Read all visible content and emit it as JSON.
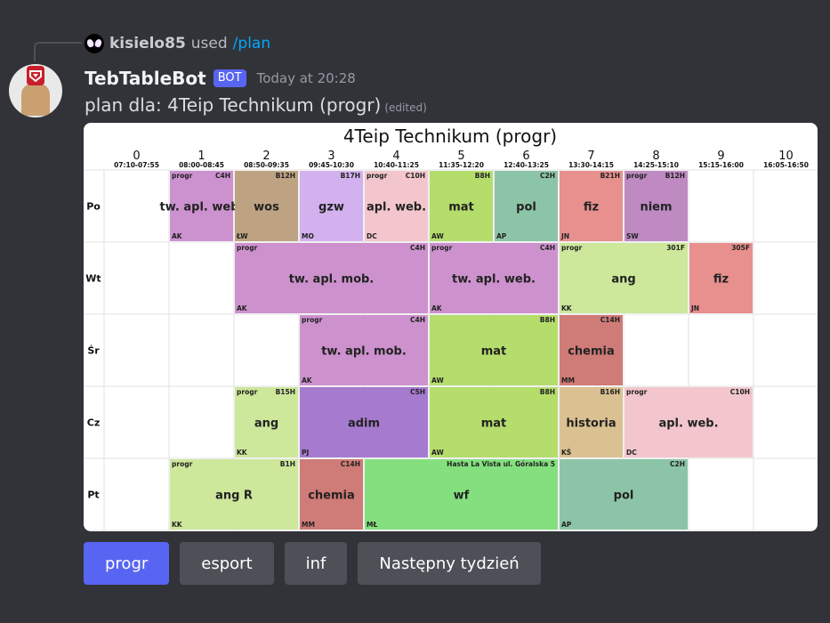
{
  "reply": {
    "user": "kisielo85",
    "verb": "used",
    "command": "/plan"
  },
  "message": {
    "bot_name": "TebTableBot",
    "bot_badge": "BOT",
    "timestamp": "Today at 20:28",
    "content": "plan dla: 4Teip Technikum (progr)",
    "edited": "(edited)"
  },
  "timetable": {
    "title": "4Teip Technikum (progr)",
    "periods": [
      {
        "num": "0",
        "time": "07:10-07:55"
      },
      {
        "num": "1",
        "time": "08:00-08:45"
      },
      {
        "num": "2",
        "time": "08:50-09:35"
      },
      {
        "num": "3",
        "time": "09:45-10:30"
      },
      {
        "num": "4",
        "time": "10:40-11:25"
      },
      {
        "num": "5",
        "time": "11:35-12:20"
      },
      {
        "num": "6",
        "time": "12:40-13:25"
      },
      {
        "num": "7",
        "time": "13:30-14:15"
      },
      {
        "num": "8",
        "time": "14:25-15:10"
      },
      {
        "num": "9",
        "time": "15:15-16:00"
      },
      {
        "num": "10",
        "time": "16:05-16:50"
      }
    ],
    "days": [
      "Po",
      "Wt",
      "Śr",
      "Cz",
      "Pt"
    ],
    "lessons": [
      {
        "day": 0,
        "start": 1,
        "span": 1,
        "name": "tw. apl. web.",
        "group": "progr",
        "room": "C4H",
        "teacher": "AK",
        "color": "#cc91cf"
      },
      {
        "day": 0,
        "start": 2,
        "span": 1,
        "name": "wos",
        "group": "",
        "room": "B12H",
        "teacher": "ŁW",
        "color": "#bea382"
      },
      {
        "day": 0,
        "start": 3,
        "span": 1,
        "name": "gzw",
        "group": "",
        "room": "B17H",
        "teacher": "MO",
        "color": "#d3b1ee"
      },
      {
        "day": 0,
        "start": 4,
        "span": 1,
        "name": "apl. web.",
        "group": "progr",
        "room": "C10H",
        "teacher": "DC",
        "color": "#f2c6cc"
      },
      {
        "day": 0,
        "start": 5,
        "span": 1,
        "name": "mat",
        "group": "",
        "room": "B8H",
        "teacher": "AW",
        "color": "#b5dd6c"
      },
      {
        "day": 0,
        "start": 6,
        "span": 1,
        "name": "pol",
        "group": "",
        "room": "C2H",
        "teacher": "AP",
        "color": "#8cc4a7"
      },
      {
        "day": 0,
        "start": 7,
        "span": 1,
        "name": "fiz",
        "group": "",
        "room": "B21H",
        "teacher": "JN",
        "color": "#e7908e"
      },
      {
        "day": 0,
        "start": 8,
        "span": 1,
        "name": "niem",
        "group": "progr",
        "room": "B12H",
        "teacher": "SW",
        "color": "#bf8ac2"
      },
      {
        "day": 1,
        "start": 2,
        "span": 3,
        "name": "tw. apl. mob.",
        "group": "progr",
        "room": "C4H",
        "teacher": "AK",
        "color": "#cd92ce"
      },
      {
        "day": 1,
        "start": 5,
        "span": 2,
        "name": "tw. apl. web.",
        "group": "progr",
        "room": "C4H",
        "teacher": "AK",
        "color": "#cd92ce"
      },
      {
        "day": 1,
        "start": 7,
        "span": 2,
        "name": "ang",
        "group": "progr",
        "room": "301F",
        "teacher": "KK",
        "color": "#cde79b"
      },
      {
        "day": 1,
        "start": 9,
        "span": 1,
        "name": "fiz",
        "group": "",
        "room": "305F",
        "teacher": "JN",
        "color": "#e7908e"
      },
      {
        "day": 2,
        "start": 3,
        "span": 2,
        "name": "tw. apl. mob.",
        "group": "progr",
        "room": "C4H",
        "teacher": "AK",
        "color": "#cd92ce"
      },
      {
        "day": 2,
        "start": 5,
        "span": 2,
        "name": "mat",
        "group": "",
        "room": "B8H",
        "teacher": "AW",
        "color": "#b5dd6c"
      },
      {
        "day": 2,
        "start": 7,
        "span": 1,
        "name": "chemia",
        "group": "",
        "room": "C14H",
        "teacher": "MM",
        "color": "#cf7b77"
      },
      {
        "day": 3,
        "start": 2,
        "span": 1,
        "name": "ang",
        "group": "progr",
        "room": "B15H",
        "teacher": "KK",
        "color": "#cde79b"
      },
      {
        "day": 3,
        "start": 3,
        "span": 2,
        "name": "adim",
        "group": "",
        "room": "C5H",
        "teacher": "PJ",
        "color": "#a67bcf"
      },
      {
        "day": 3,
        "start": 5,
        "span": 2,
        "name": "mat",
        "group": "",
        "room": "B8H",
        "teacher": "AW",
        "color": "#b5dd6c"
      },
      {
        "day": 3,
        "start": 7,
        "span": 1,
        "name": "historia",
        "group": "",
        "room": "B16H",
        "teacher": "KŚ",
        "color": "#dbc191"
      },
      {
        "day": 3,
        "start": 8,
        "span": 2,
        "name": "apl. web.",
        "group": "progr",
        "room": "C10H",
        "teacher": "DC",
        "color": "#f2c6cc"
      },
      {
        "day": 4,
        "start": 1,
        "span": 2,
        "name": "ang R",
        "group": "progr",
        "room": "B1H",
        "teacher": "KK",
        "color": "#cde79b"
      },
      {
        "day": 4,
        "start": 3,
        "span": 1,
        "name": "chemia",
        "group": "",
        "room": "C14H",
        "teacher": "MM",
        "color": "#cf7b77"
      },
      {
        "day": 4,
        "start": 4,
        "span": 3,
        "name": "wf",
        "group": "",
        "room": "Hasta La Vista ul. Góralska 5",
        "teacher": "MŁ",
        "color": "#84e07f"
      },
      {
        "day": 4,
        "start": 7,
        "span": 2,
        "name": "pol",
        "group": "",
        "room": "C2H",
        "teacher": "AP",
        "color": "#8cc4a7"
      }
    ]
  },
  "buttons": [
    {
      "label": "progr",
      "style": "primary"
    },
    {
      "label": "esport",
      "style": "secondary"
    },
    {
      "label": "inf",
      "style": "secondary"
    },
    {
      "label": "Następny tydzień",
      "style": "secondary"
    }
  ]
}
